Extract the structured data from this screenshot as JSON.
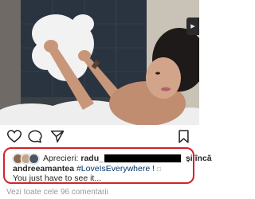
{
  "post": {
    "photo_description_icon": "photo",
    "badge_icon": "reel-icon"
  },
  "actions": {
    "heart_icon": "heart-icon",
    "comment_icon": "comment-icon",
    "share_icon": "send-icon",
    "bookmark_icon": "bookmark-icon"
  },
  "likes": {
    "label": "Aprecieri:",
    "first_liker": "radu_",
    "and_more": "și încă"
  },
  "caption": {
    "username": "andreeamantea",
    "hashtag": "#LoveIsEverywhere",
    "suffix": " ! ",
    "emoji_placeholder": "□",
    "line2": "You just have to see it..."
  },
  "comments": {
    "view_all": "Vezi toate cele 96 comentarii"
  },
  "colors": {
    "highlight_border": "#d2232a",
    "hashtag": "#003569",
    "muted": "#9a9a9a"
  }
}
